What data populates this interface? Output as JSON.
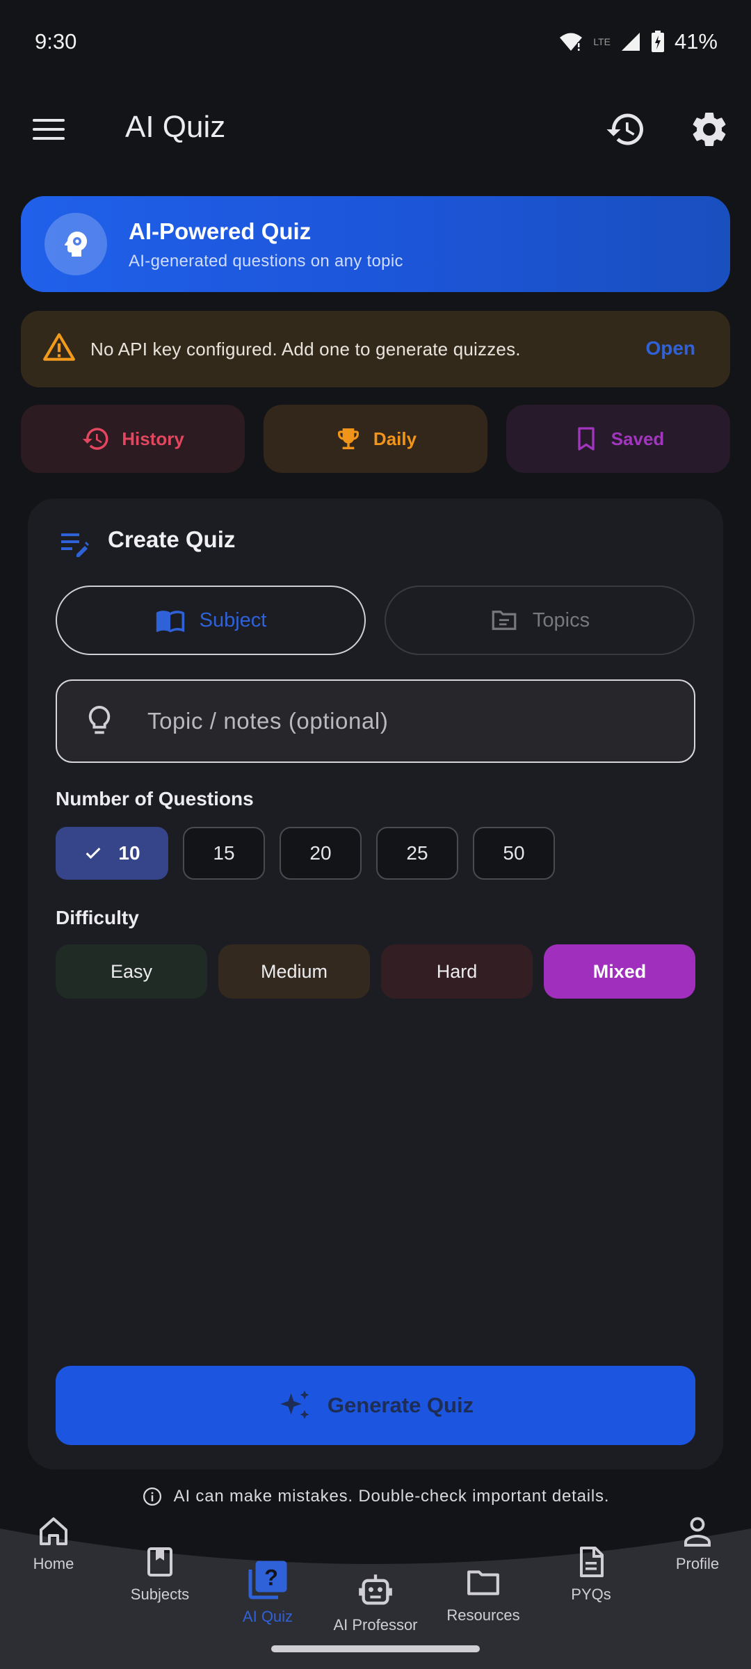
{
  "status_bar": {
    "time": "9:30",
    "battery": "41%"
  },
  "app_bar": {
    "title": "AI Quiz",
    "icons": [
      "menu-icon",
      "history-icon",
      "gear-icon"
    ]
  },
  "hero": {
    "title": "AI-Powered Quiz",
    "subtitle": "AI-generated questions on any topic",
    "icon": "brain-gear-icon"
  },
  "warning": {
    "text": "No API key configured. Add one to generate quizzes.",
    "action": "Open"
  },
  "quick_actions": [
    {
      "label": "History",
      "icon": "history-icon",
      "color": "#e2475f"
    },
    {
      "label": "Daily",
      "icon": "trophy-icon",
      "color": "#f1951a"
    },
    {
      "label": "Saved",
      "icon": "bookmark-icon",
      "color": "#a336bf"
    }
  ],
  "create_quiz": {
    "title": "Create Quiz",
    "modes": [
      {
        "label": "Subject",
        "selected": true
      },
      {
        "label": "Topics",
        "selected": false
      }
    ],
    "topic_placeholder": "Topic / notes (optional)",
    "topic_value": "",
    "num_label": "Number of Questions",
    "num_options": [
      "10",
      "15",
      "20",
      "25",
      "50"
    ],
    "num_selected": "10",
    "difficulty_label": "Difficulty",
    "difficulties": [
      "Easy",
      "Medium",
      "Hard",
      "Mixed"
    ],
    "difficulty_selected": "Mixed",
    "generate_label": "Generate Quiz"
  },
  "disclaimer": "AI can make mistakes. Double-check important details.",
  "bottom_nav": [
    {
      "label": "Home",
      "icon": "home-icon"
    },
    {
      "label": "Subjects",
      "icon": "book-icon"
    },
    {
      "label": "AI Quiz",
      "icon": "quiz-icon",
      "active": true
    },
    {
      "label": "AI Professor",
      "icon": "robot-icon"
    },
    {
      "label": "Resources",
      "icon": "folder-icon"
    },
    {
      "label": "PYQs",
      "icon": "document-icon"
    },
    {
      "label": "Profile",
      "icon": "person-icon"
    }
  ],
  "colors": {
    "accent": "#1c56e0",
    "background": "#131418",
    "card": "#1c1d22",
    "mixed": "#a12fbd"
  }
}
